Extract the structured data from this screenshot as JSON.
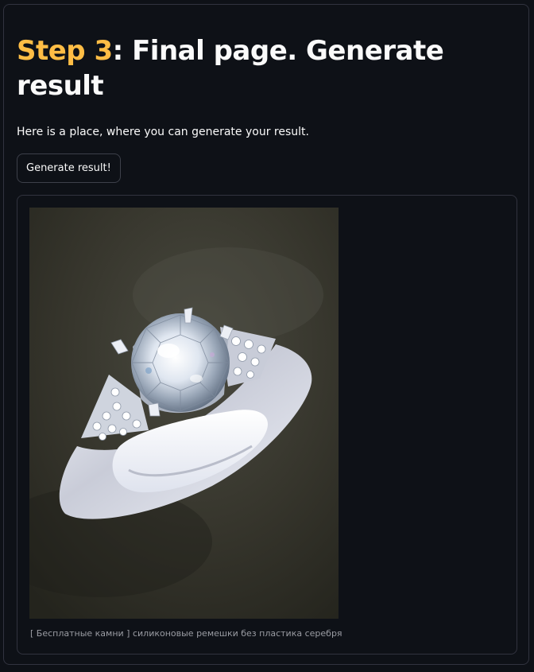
{
  "heading": {
    "step": "Step 3",
    "rest": ": Final page. Generate result"
  },
  "description": "Here is a place, where you can generate your result.",
  "generate_button": {
    "label": "Generate result!"
  },
  "result": {
    "caption": "[ Бесплатные камни ] силиконовые ремешки без пластика серебря"
  },
  "colors": {
    "background": "#0e1117",
    "accent": "#ffbd45",
    "text": "#fafafa",
    "border": "#31333f"
  }
}
